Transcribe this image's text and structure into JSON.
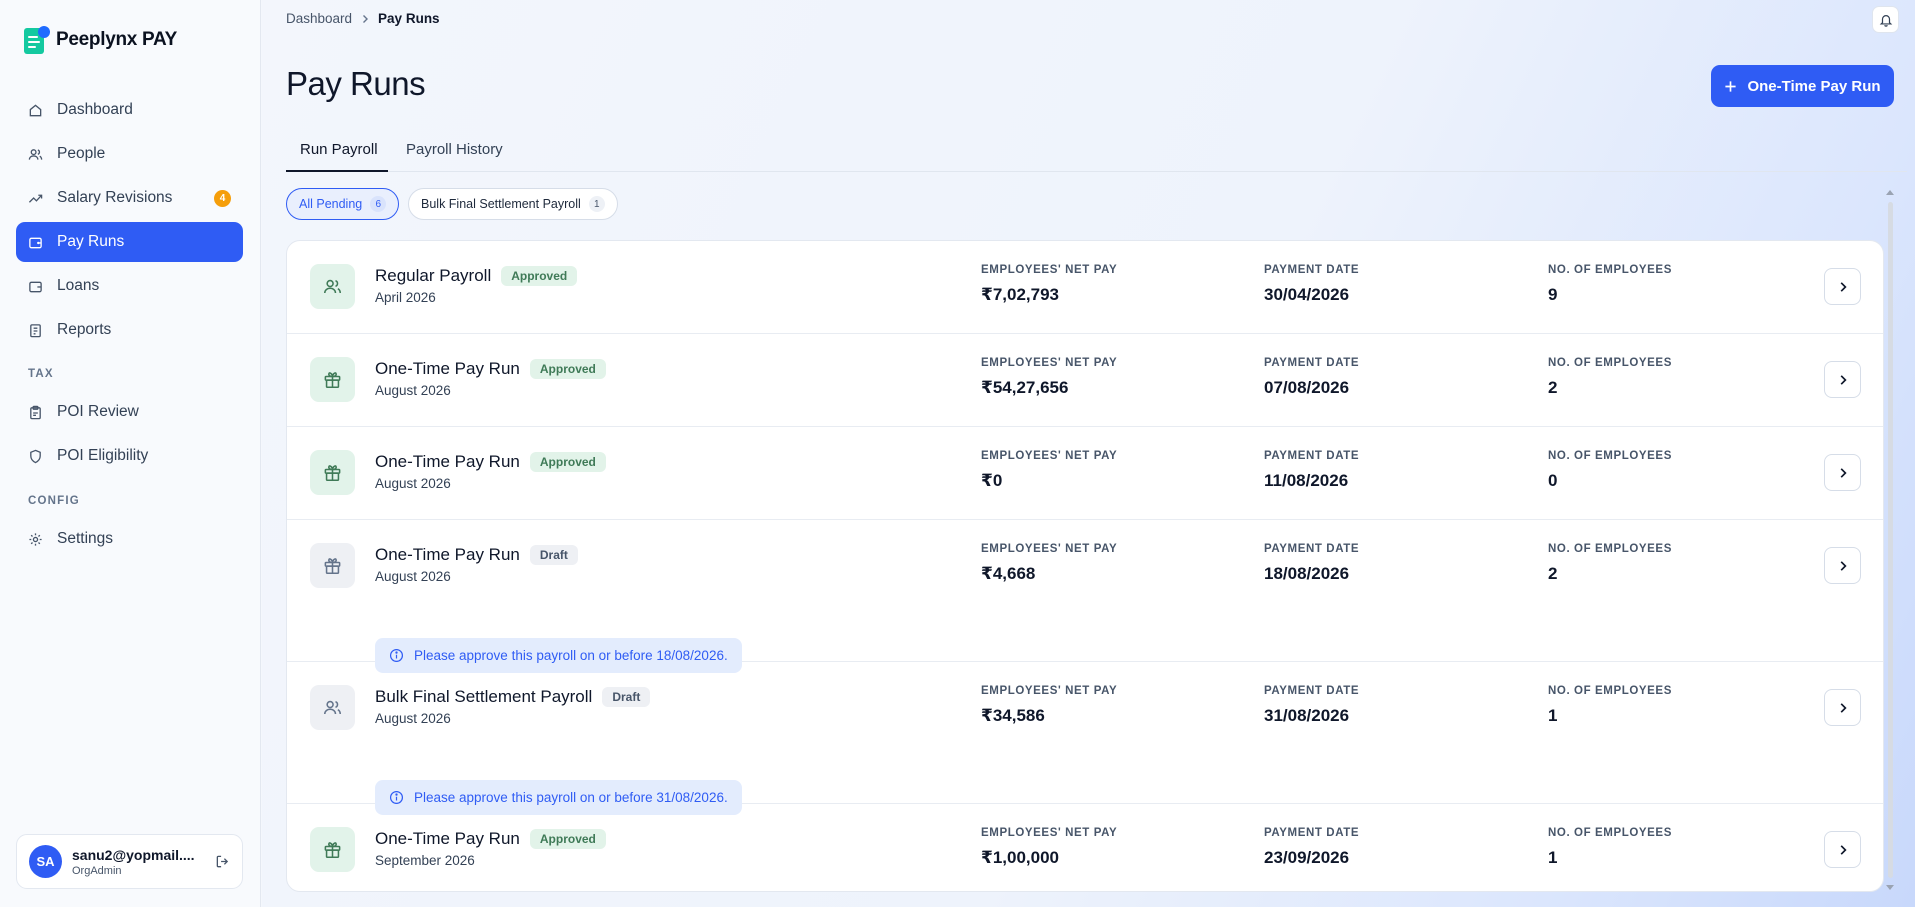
{
  "brand": {
    "name": "Peeplynx PAY"
  },
  "sidebar": {
    "items": [
      {
        "label": "Dashboard",
        "icon": "home-icon"
      },
      {
        "label": "People",
        "icon": "users-icon"
      },
      {
        "label": "Salary Revisions",
        "icon": "trend-icon",
        "badge": "4"
      },
      {
        "label": "Pay Runs",
        "icon": "wallet-icon",
        "active": true
      },
      {
        "label": "Loans",
        "icon": "wallet-icon"
      },
      {
        "label": "Reports",
        "icon": "report-icon"
      }
    ],
    "tax_section": "TAX",
    "tax_items": [
      {
        "label": "POI Review",
        "icon": "clipboard-icon"
      },
      {
        "label": "POI Eligibility",
        "icon": "shield-icon"
      }
    ],
    "config_section": "CONFIG",
    "config_items": [
      {
        "label": "Settings",
        "icon": "gear-icon"
      }
    ]
  },
  "user": {
    "initials": "SA",
    "email": "sanu2@yopmail....",
    "role": "OrgAdmin"
  },
  "breadcrumb": {
    "parent": "Dashboard",
    "current": "Pay Runs"
  },
  "page": {
    "title": "Pay Runs",
    "primary_button": "One-Time Pay Run"
  },
  "tabs": [
    {
      "label": "Run Payroll",
      "active": true
    },
    {
      "label": "Payroll History"
    }
  ],
  "filters": [
    {
      "label": "All Pending",
      "count": "6",
      "active": true
    },
    {
      "label": "Bulk Final Settlement Payroll",
      "count": "1"
    }
  ],
  "columns": {
    "net_pay": "EMPLOYEES' NET PAY",
    "payment_date": "PAYMENT DATE",
    "employees": "NO. OF EMPLOYEES"
  },
  "payruns": [
    {
      "title": "Regular Payroll",
      "status": "Approved",
      "period": "April 2026",
      "net_pay": "₹7,02,793",
      "payment_date": "30/04/2026",
      "employees": "9",
      "icon": "users-icon",
      "notice": ""
    },
    {
      "title": "One-Time Pay Run",
      "status": "Approved",
      "period": "August 2026",
      "net_pay": "₹54,27,656",
      "payment_date": "07/08/2026",
      "employees": "2",
      "icon": "gift-icon",
      "notice": ""
    },
    {
      "title": "One-Time Pay Run",
      "status": "Approved",
      "period": "August 2026",
      "net_pay": "₹0",
      "payment_date": "11/08/2026",
      "employees": "0",
      "icon": "gift-icon",
      "notice": ""
    },
    {
      "title": "One-Time Pay Run",
      "status": "Draft",
      "period": "August 2026",
      "net_pay": "₹4,668",
      "payment_date": "18/08/2026",
      "employees": "2",
      "icon": "gift-icon",
      "notice": "Please approve this payroll on or before 18/08/2026."
    },
    {
      "title": "Bulk Final Settlement Payroll",
      "status": "Draft",
      "period": "August 2026",
      "net_pay": "₹34,586",
      "payment_date": "31/08/2026",
      "employees": "1",
      "icon": "users-icon",
      "notice": "Please approve this payroll on or before 31/08/2026."
    },
    {
      "title": "One-Time Pay Run",
      "status": "Approved",
      "period": "September 2026",
      "net_pay": "₹1,00,000",
      "payment_date": "23/09/2026",
      "employees": "1",
      "icon": "gift-icon",
      "notice": ""
    }
  ],
  "colors": {
    "accent": "#2f5cf4",
    "approved": "#3f7a57",
    "badge": "#f59e0b"
  }
}
